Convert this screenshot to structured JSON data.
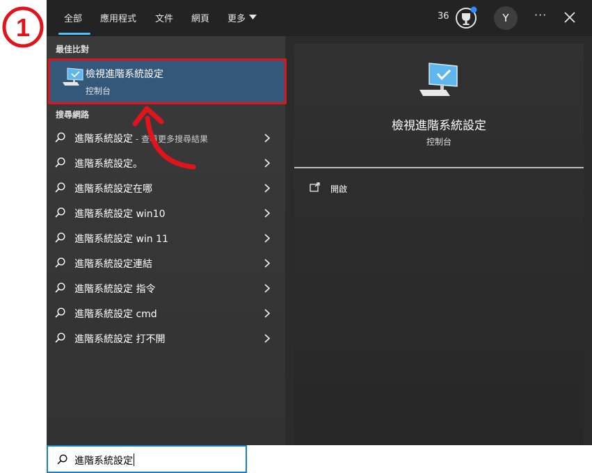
{
  "step_badge": "1",
  "tabs": [
    {
      "label": "全部",
      "active": true
    },
    {
      "label": "應用程式"
    },
    {
      "label": "文件"
    },
    {
      "label": "網頁"
    },
    {
      "label": "更多"
    }
  ],
  "header": {
    "reward_count": "36",
    "avatar_initial": "Y"
  },
  "best_match": {
    "section_title": "最佳比對",
    "title": "檢視進階系統設定",
    "subtitle": "控制台"
  },
  "web": {
    "section_title": "搜尋網路",
    "items": [
      {
        "label": "進階系統設定",
        "suffix": " - 查看更多搜尋結果"
      },
      {
        "label": "進階系統設定。"
      },
      {
        "label": "進階系統設定在哪"
      },
      {
        "label": "進階系統設定 win10"
      },
      {
        "label": "進階系統設定 win 11"
      },
      {
        "label": "進階系統設定連結"
      },
      {
        "label": "進階系統設定 指令"
      },
      {
        "label": "進階系統設定 cmd"
      },
      {
        "label": "進階系統設定 打不開"
      }
    ]
  },
  "detail": {
    "title": "檢視進階系統設定",
    "subtitle": "控制台",
    "actions": [
      {
        "label": "開啟"
      }
    ]
  },
  "search": {
    "query": "進階系統設定"
  },
  "colors": {
    "accent": "#4cc2ff",
    "selection": "#33587a",
    "annotation_red": "#e0141c",
    "searchbox_border": "#1580d0"
  },
  "icons": {
    "best_match_icon": "monitor-check-icon",
    "web_item_icon": "search-icon",
    "chevron": "chevron-right-icon",
    "open_action": "open-external-icon",
    "reward": "reward-trophy-icon"
  }
}
